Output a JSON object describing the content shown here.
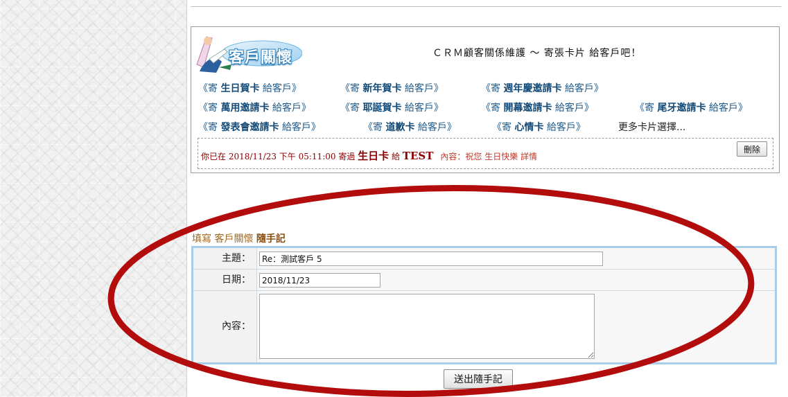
{
  "header": {
    "logo_text": "客戶關懷",
    "slogan": "ＣＲＭ顧客關係維護 ～ 寄張卡片 給客戶吧！"
  },
  "cards": {
    "prefix": "《寄 ",
    "suffix": " 給客戶》",
    "items": [
      {
        "name": "生日賀卡"
      },
      {
        "name": "新年賀卡"
      },
      {
        "name": "週年慶邀請卡"
      },
      {
        "name": "萬用邀請卡"
      },
      {
        "name": "耶誕賀卡"
      },
      {
        "name": "開幕邀請卡"
      },
      {
        "name": "尾牙邀請卡"
      },
      {
        "name": "發表會邀請卡"
      },
      {
        "name": "道歉卡"
      },
      {
        "name": "心情卡"
      }
    ],
    "more": "更多卡片選擇..."
  },
  "sent": {
    "intro": "你已在 2018/11/23 下午 05:11:00 寄過 ",
    "card": "生日卡",
    "to": " 給 ",
    "recipient": "TEST",
    "content_label": "內容：",
    "content": "祝您 生日快樂",
    "detail": " 詳情",
    "delete_label": "刪除"
  },
  "memo": {
    "title_prefix": "填寫 客戶關懷 ",
    "title_bold": "隨手記",
    "subject_label": "主題：",
    "subject_value": "Re：測試客戶 5",
    "date_label": "日期：",
    "date_value": "2018/11/23",
    "content_label": "內容：",
    "content_value": "",
    "submit_label": "送出隨手記"
  },
  "colors": {
    "annotation_ellipse": "#b30c0c",
    "memo_border": "#a9cde8"
  }
}
